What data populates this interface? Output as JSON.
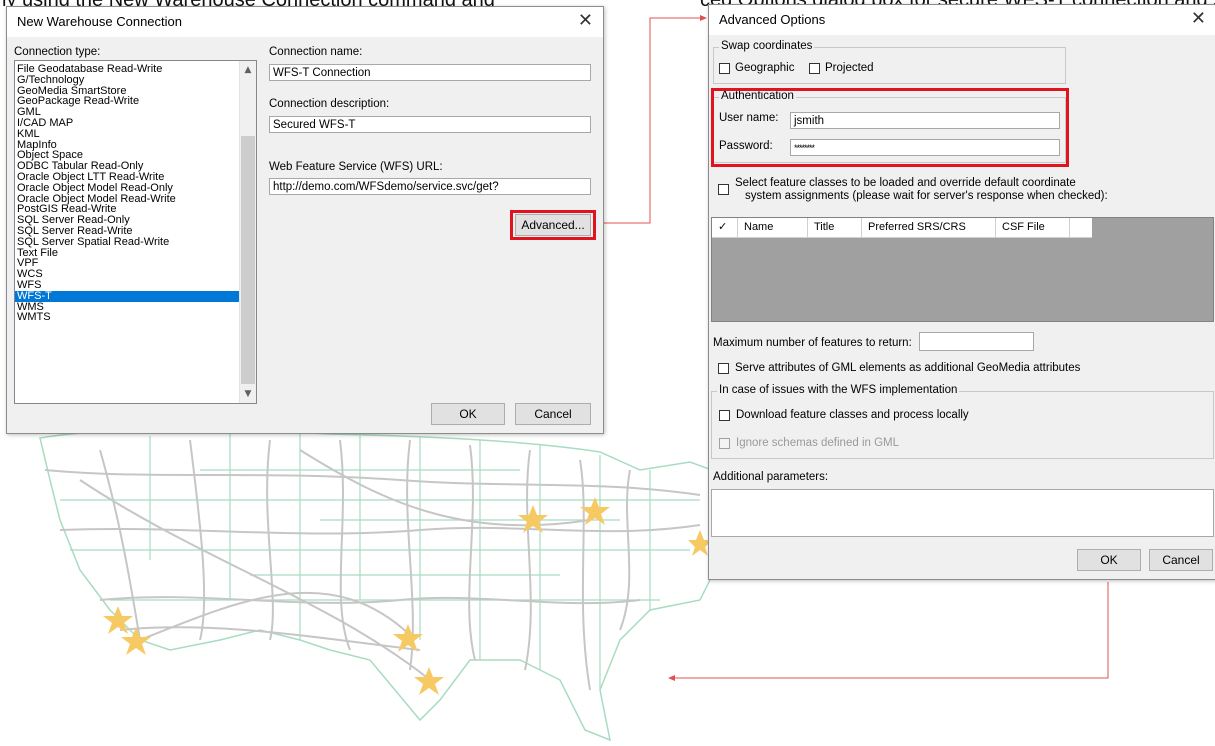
{
  "caption": {
    "left_text": "ly using the New Warehouse Connection command and",
    "right_text": "ced Options dialog box for secure WFS-T connection and specify cre"
  },
  "warehouse_dialog": {
    "title": "New Warehouse Connection",
    "close_glyph": "✕",
    "connection_type_label": "Connection type:",
    "connection_types": [
      "File Geodatabase Read-Write",
      "G/Technology",
      "GeoMedia SmartStore",
      "GeoPackage Read-Write",
      "GML",
      "I/CAD MAP",
      "KML",
      "MapInfo",
      "Object Space",
      "ODBC Tabular Read-Only",
      "Oracle Object LTT Read-Write",
      "Oracle Object Model Read-Only",
      "Oracle Object Model Read-Write",
      "PostGIS Read-Write",
      "SQL Server Read-Only",
      "SQL Server Read-Write",
      "SQL Server Spatial Read-Write",
      "Text File",
      "VPF",
      "WCS",
      "WFS",
      "WFS-T",
      "WMS",
      "WMTS"
    ],
    "selected_type": "WFS-T",
    "connection_name_label": "Connection name:",
    "connection_name_value": "WFS-T Connection",
    "connection_description_label": "Connection description:",
    "connection_description_value": "Secured WFS-T",
    "wfs_url_label": "Web Feature Service (WFS) URL:",
    "wfs_url_value": "http://demo.com/WFSdemo/service.svc/get?",
    "advanced_button": "Advanced...",
    "ok_button": "OK",
    "cancel_button": "Cancel"
  },
  "advanced_dialog": {
    "title": "Advanced Options",
    "close_glyph": "✕",
    "swap_group_label": "Swap coordinates",
    "geographic_label": "Geographic",
    "projected_label": "Projected",
    "auth_group_label": "Authentication",
    "username_label": "User name:",
    "username_value": "jsmith",
    "password_label": "Password:",
    "password_value": "********",
    "select_classes_text": "Select feature classes to be loaded and override default coordinate",
    "select_classes_text2": "system assignments (please wait for server's response when checked):",
    "grid_columns": [
      "✓",
      "Name",
      "Title",
      "Preferred SRS/CRS",
      "CSF File"
    ],
    "max_features_label": "Maximum number of features to return:",
    "max_features_value": "",
    "serve_attributes_label": "Serve attributes of GML elements as additional GeoMedia attributes",
    "issues_group_label": "In case of issues with the WFS implementation",
    "download_label": "Download feature classes and process locally",
    "ignore_label": "Ignore schemas defined in GML",
    "additional_params_label": "Additional parameters:",
    "additional_params_value": "",
    "ok_button": "OK",
    "cancel_button": "Cancel"
  },
  "colors": {
    "highlight_red": "#e0141e",
    "selection_blue": "#0078d7",
    "map_state_lines": "#a8dcc0",
    "map_roads": "#c6c6c6",
    "star_fill": "#f7c963"
  }
}
